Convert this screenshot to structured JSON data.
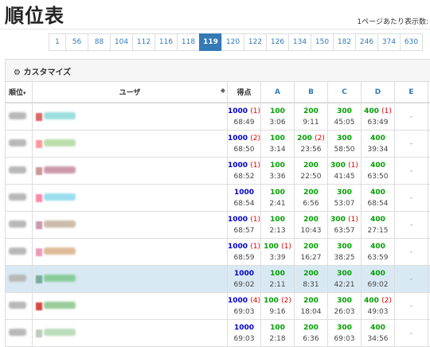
{
  "title": "順位表",
  "per_page_label": "1ページあたり表示数:",
  "pager": [
    "1",
    "56",
    "88",
    "104",
    "112",
    "116",
    "118",
    "119",
    "120",
    "122",
    "126",
    "134",
    "150",
    "182",
    "246",
    "374",
    "630"
  ],
  "pager_active": "119",
  "customize_label": "カスタマイズ",
  "headers": {
    "rank": "順位",
    "user": "ユーザ",
    "score": "得点",
    "problems": [
      "A",
      "B",
      "C",
      "D",
      "E"
    ]
  },
  "rows": [
    {
      "score": "1000",
      "penalty": "(1)",
      "time": "68:49",
      "A": [
        "100",
        "",
        "3:06"
      ],
      "B": [
        "200",
        "",
        "9:11"
      ],
      "C": [
        "300",
        "",
        "45:05"
      ],
      "D": [
        "400",
        "(1)",
        "63:49"
      ],
      "E": "-",
      "highlight": false
    },
    {
      "score": "1000",
      "penalty": "(2)",
      "time": "68:50",
      "A": [
        "100",
        "",
        "3:14"
      ],
      "B": [
        "200",
        "(2)",
        "23:56"
      ],
      "C": [
        "300",
        "",
        "58:50"
      ],
      "D": [
        "400",
        "",
        "39:34"
      ],
      "E": "-",
      "highlight": false
    },
    {
      "score": "1000",
      "penalty": "(1)",
      "time": "68:52",
      "A": [
        "100",
        "",
        "3:36"
      ],
      "B": [
        "200",
        "",
        "22:50"
      ],
      "C": [
        "300",
        "(1)",
        "41:45"
      ],
      "D": [
        "400",
        "",
        "63:50"
      ],
      "E": "-",
      "highlight": false
    },
    {
      "score": "1000",
      "penalty": "",
      "time": "68:54",
      "A": [
        "100",
        "",
        "2:41"
      ],
      "B": [
        "200",
        "",
        "6:56"
      ],
      "C": [
        "300",
        "",
        "53:07"
      ],
      "D": [
        "400",
        "",
        "68:54"
      ],
      "E": "-",
      "highlight": false
    },
    {
      "score": "1000",
      "penalty": "(1)",
      "time": "68:57",
      "A": [
        "100",
        "",
        "2:13"
      ],
      "B": [
        "200",
        "",
        "10:43"
      ],
      "C": [
        "300",
        "(1)",
        "63:57"
      ],
      "D": [
        "400",
        "",
        "27:15"
      ],
      "E": "-",
      "highlight": false
    },
    {
      "score": "1000",
      "penalty": "(1)",
      "time": "68:59",
      "A": [
        "100",
        "(1)",
        "3:39"
      ],
      "B": [
        "200",
        "",
        "16:27"
      ],
      "C": [
        "300",
        "",
        "38:25"
      ],
      "D": [
        "400",
        "",
        "63:59"
      ],
      "E": "-",
      "highlight": false
    },
    {
      "score": "1000",
      "penalty": "",
      "time": "69:02",
      "A": [
        "100",
        "",
        "2:11"
      ],
      "B": [
        "200",
        "",
        "8:31"
      ],
      "C": [
        "300",
        "",
        "42:21"
      ],
      "D": [
        "400",
        "",
        "69:02"
      ],
      "E": "-",
      "highlight": true
    },
    {
      "score": "1000",
      "penalty": "(4)",
      "time": "69:03",
      "A": [
        "100",
        "(2)",
        "9:16"
      ],
      "B": [
        "200",
        "",
        "18:04"
      ],
      "C": [
        "300",
        "",
        "26:03"
      ],
      "D": [
        "400",
        "(2)",
        "49:03"
      ],
      "E": "-",
      "highlight": false
    },
    {
      "score": "1000",
      "penalty": "",
      "time": "69:03",
      "A": [
        "100",
        "",
        "2:18"
      ],
      "B": [
        "200",
        "",
        "6:36"
      ],
      "C": [
        "300",
        "",
        "69:03"
      ],
      "D": [
        "400",
        "",
        "34:56"
      ],
      "E": "-",
      "highlight": false
    }
  ],
  "blur_colors": {
    "rank": "#b8b8b8",
    "user_a": [
      "#d66",
      "#f99",
      "#c99",
      "#f8a",
      "#c9a",
      "#e9b",
      "#7a9",
      "#d44",
      "#bcb"
    ],
    "user_b": [
      "#9dd",
      "#bda",
      "#c9a",
      "#9de",
      "#cba",
      "#db9",
      "#8c9",
      "#9c9",
      "#bdb"
    ]
  }
}
